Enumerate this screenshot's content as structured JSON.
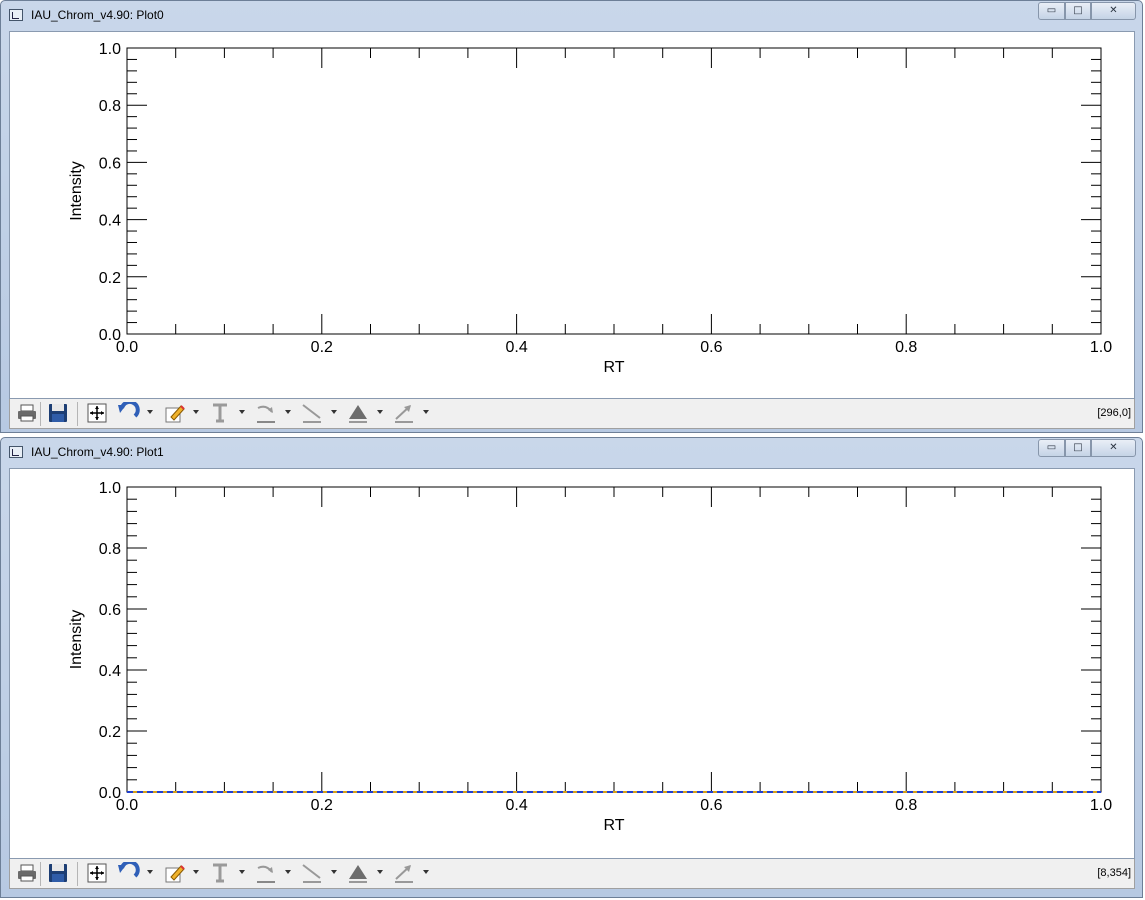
{
  "windows": [
    {
      "title": "IAU_Chrom_v4.90: Plot0",
      "status": "[296,0]",
      "chart_data": {
        "type": "line",
        "title": "",
        "xlabel": "RT",
        "ylabel": "Intensity",
        "xlim": [
          0.0,
          1.0
        ],
        "ylim": [
          0.0,
          1.0
        ],
        "xticks": [
          "0.0",
          "0.2",
          "0.4",
          "0.6",
          "0.8",
          "1.0"
        ],
        "yticks": [
          "0.0",
          "0.2",
          "0.4",
          "0.6",
          "0.8",
          "1.0"
        ],
        "grid": false,
        "series": []
      }
    },
    {
      "title": "IAU_Chrom_v4.90: Plot1",
      "status": "[8,354]",
      "chart_data": {
        "type": "line",
        "title": "",
        "xlabel": "RT",
        "ylabel": "Intensity",
        "xlim": [
          0.0,
          1.0
        ],
        "ylim": [
          0.0,
          1.0
        ],
        "xticks": [
          "0.0",
          "0.2",
          "0.4",
          "0.6",
          "0.8",
          "1.0"
        ],
        "yticks": [
          "0.0",
          "0.2",
          "0.4",
          "0.6",
          "0.8",
          "1.0"
        ],
        "grid": false,
        "series": [
          {
            "x": [
              0.0,
              1.0
            ],
            "y": [
              0.0,
              0.0
            ],
            "color": "#d4a017",
            "style": "solid"
          },
          {
            "x": [
              0.0,
              1.0
            ],
            "y": [
              0.0,
              0.0
            ],
            "color": "#1f3fd0",
            "style": "dashed"
          }
        ]
      }
    }
  ],
  "window_controls": {
    "minimize": "▭",
    "maximize": "□",
    "close": "✕"
  },
  "toolbar_icons": [
    "print-icon",
    "save-icon",
    "reset-view-icon",
    "undo-icon",
    "edit-pencil-icon",
    "text-icon",
    "line-tool-icon",
    "diagonal-line-icon",
    "triangle-icon",
    "arrow-icon"
  ],
  "colors": {
    "titlebar": "#c2d2e8",
    "toolbar": "#f0f0f0",
    "axis": "#000000"
  }
}
